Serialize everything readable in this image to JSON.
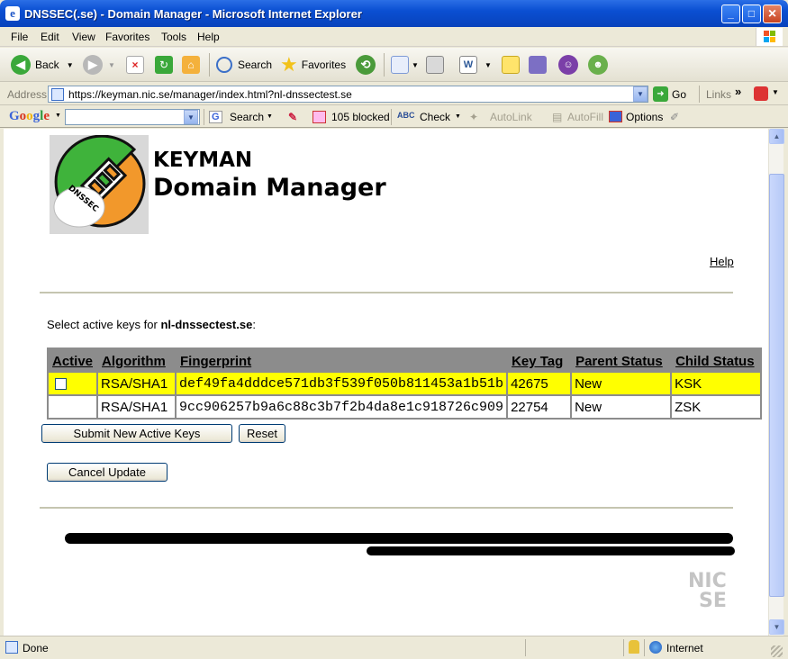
{
  "window": {
    "title": "DNSSEC(.se) - Domain Manager - Microsoft Internet Explorer",
    "minimize": "_",
    "maximize": "□",
    "close": "×"
  },
  "menu": [
    {
      "label": "File"
    },
    {
      "label": "Edit"
    },
    {
      "label": "View"
    },
    {
      "label": "Favorites"
    },
    {
      "label": "Tools"
    },
    {
      "label": "Help"
    }
  ],
  "toolbar": {
    "back": "Back",
    "search": "Search",
    "favorites": "Favorites"
  },
  "address": {
    "label": "Address",
    "url": "https://keyman.nic.se/manager/index.html?nl-dnssectest.se",
    "go": "Go",
    "links": "Links"
  },
  "google": {
    "logo": "Google",
    "search": "Search",
    "blocked": "105 blocked",
    "check": "Check",
    "autolink": "AutoLink",
    "autofill": "AutoFill",
    "options": "Options"
  },
  "page": {
    "logo_text": "DNSSEC",
    "heading1": "KEYMAN",
    "heading2": "Domain Manager",
    "help": "Help",
    "intro_prefix": "Select active keys for ",
    "domain": "nl-dnssectest.se",
    "intro_suffix": ":",
    "table": {
      "headers": [
        "Active",
        "Algorithm",
        "Fingerprint",
        "Key Tag",
        "Parent Status",
        "Child Status"
      ],
      "rows": [
        {
          "active": false,
          "algorithm": "RSA/SHA1",
          "fingerprint": "def49fa4dddce571db3f539f050b811453a1b51b",
          "key_tag": "42675",
          "parent_status": "New",
          "child_status": "KSK"
        },
        {
          "active": null,
          "algorithm": "RSA/SHA1",
          "fingerprint": "9cc906257b9a6c88c3b7f2b4da8e1c918726c909",
          "key_tag": "22754",
          "parent_status": "New",
          "child_status": "ZSK"
        }
      ]
    },
    "submit": "Submit New Active Keys",
    "reset": "Reset",
    "cancel": "Cancel Update",
    "footer_logo_top": "NIC",
    "footer_logo_bottom": "SE"
  },
  "status": {
    "text": "Done",
    "zone": "Internet"
  },
  "colors": {
    "highlight_row": "#ffff00",
    "table_header": "#8c8c8c",
    "logo_green": "#3fb33b",
    "logo_orange": "#f2982b"
  }
}
